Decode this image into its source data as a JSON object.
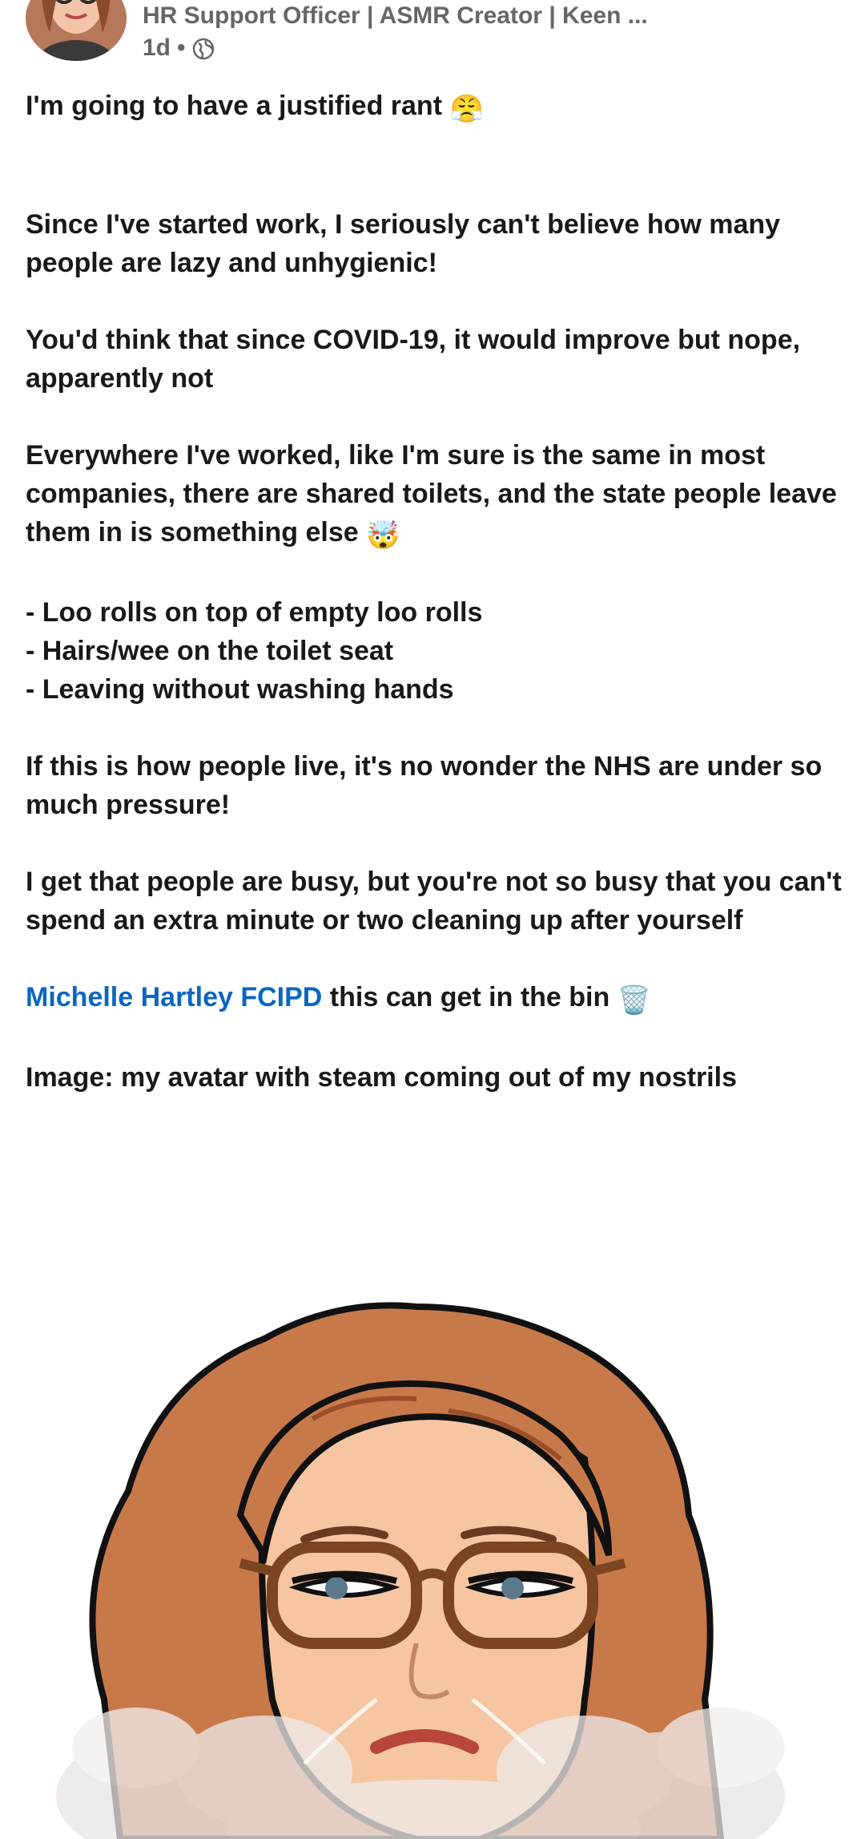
{
  "author": {
    "headline": "HR Support Officer | ASMR Creator | Keen ...",
    "time": "1d",
    "separator": "•",
    "visibility_icon": "globe-icon"
  },
  "post": {
    "line1": "I'm going to have a justified rant",
    "emoji1": "😤",
    "para1": "Since I've started work, I seriously can't believe how many people are lazy and unhygienic!",
    "para2": "You'd think that since COVID-19, it would improve but nope, apparently not",
    "para3": "Everywhere I've worked, like I'm sure is the same in most companies, there are shared toilets, and the state people leave them in is something else",
    "emoji2": "🤯",
    "bullet1": "- Loo rolls on top of empty loo rolls",
    "bullet2": "- Hairs/wee on the toilet seat",
    "bullet3": "- Leaving without washing hands",
    "para4": "If this is how people live, it's no wonder the NHS are under so much pressure!",
    "para5": "I get that people are busy, but you're not so busy that you can't spend an extra minute or two cleaning up after yourself",
    "mention": "Michelle Hartley FCIPD",
    "mention_suffix": "this can get in the bin",
    "emoji3": "🗑️",
    "image_caption": "Image: my avatar with steam coming out of my nostrils"
  },
  "colors": {
    "mention": "#0a66c2",
    "text": "#191919",
    "meta": "#666666"
  }
}
